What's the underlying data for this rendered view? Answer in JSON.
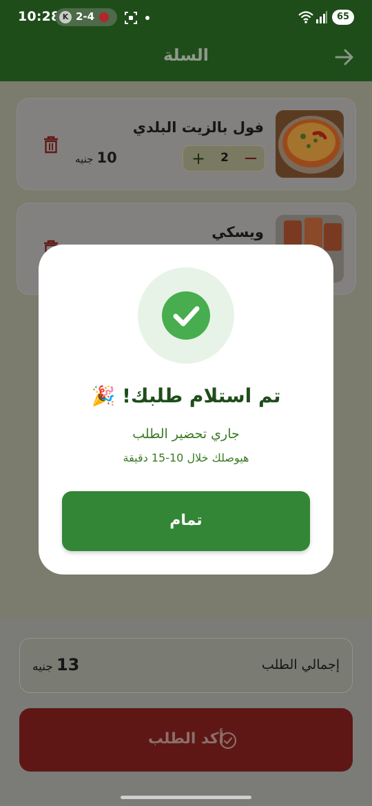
{
  "status_bar": {
    "time": "10:28",
    "notification_badge": "K",
    "match_score": "2-4",
    "battery": "65",
    "icons": [
      "screenshot-icon",
      "wifi-icon",
      "signal-icon",
      "battery-icon"
    ]
  },
  "header": {
    "title": "السلة",
    "back_icon": "arrow-right-icon"
  },
  "cart": {
    "items": [
      {
        "name": "فول بالزيت البلدي",
        "quantity": "2",
        "price": "10",
        "currency": "جنيه"
      },
      {
        "name": "ويسكي",
        "quantity": "",
        "price": "",
        "currency": ""
      }
    ]
  },
  "summary": {
    "total_label": "إجمالي الطلب",
    "total_value": "13",
    "currency": "جنيه",
    "confirm_label": "أكد الطلب"
  },
  "modal": {
    "title": "تم استلام طلبك! 🎉",
    "subtitle": "جاري تحضير الطلب",
    "eta": "هيوصلك خلال 10-15 دقيقة",
    "done_label": "تمام"
  },
  "colors": {
    "brand_green": "#1f4d1a",
    "success_green": "#47ad4e",
    "button_green": "#338635",
    "confirm_red": "#b72b26",
    "delete_red": "#c0392b"
  }
}
